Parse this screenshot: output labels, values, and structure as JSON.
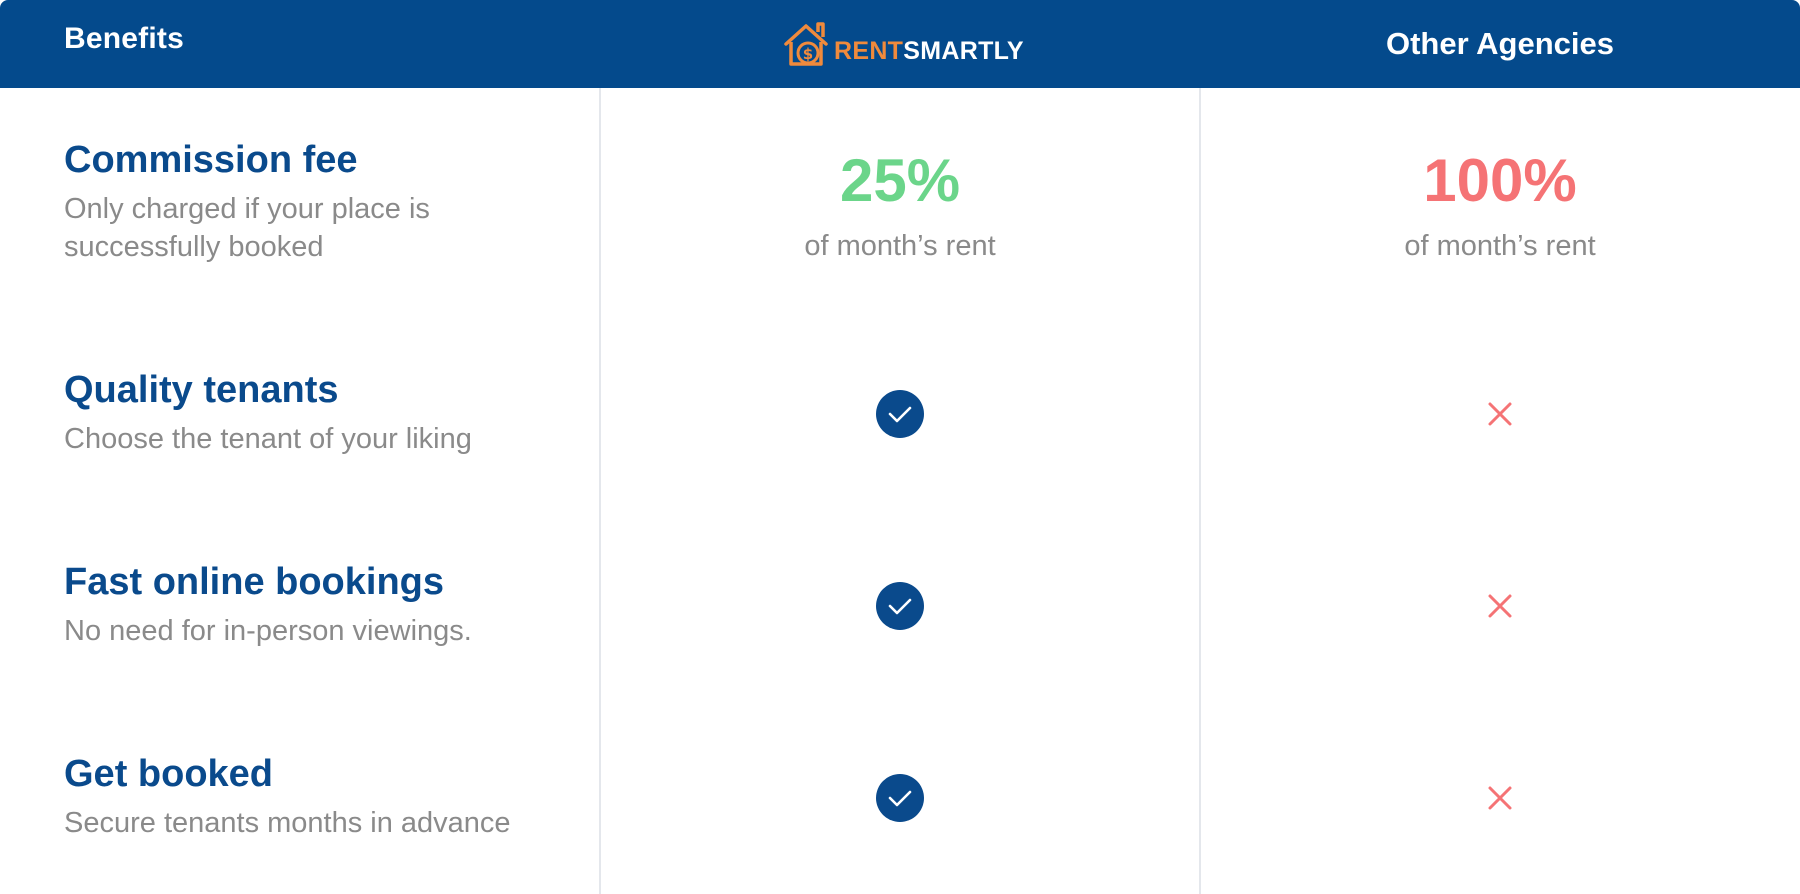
{
  "header": {
    "benefits_label": "Benefits",
    "logo": {
      "rent": "RENT",
      "smartly": "SMARTLY",
      "icon": "house-dollar-icon"
    },
    "other_label": "Other Agencies"
  },
  "colors": {
    "header_bg": "#044a8c",
    "accent_orange": "#f08a3c",
    "title_blue": "#0a4a8c",
    "good_green": "#6bd58a",
    "bad_red": "#f57375",
    "muted_text": "#8a8a8a"
  },
  "rows": [
    {
      "title": "Commission fee",
      "desc_line1": "Only charged if your place is",
      "desc_line2": "successfully booked",
      "rentsmartly": {
        "value": "25%",
        "sub": "of month’s rent"
      },
      "other": {
        "value": "100%",
        "sub": "of month’s rent"
      }
    },
    {
      "title": "Quality tenants",
      "desc": "Choose the tenant of your liking",
      "rentsmartly_icon": "check-circle-icon",
      "other_icon": "cross-icon"
    },
    {
      "title": "Fast online bookings",
      "desc": "No need for in-person viewings.",
      "rentsmartly_icon": "check-circle-icon",
      "other_icon": "cross-icon"
    },
    {
      "title": "Get booked",
      "desc": "Secure tenants months in advance",
      "rentsmartly_icon": "check-circle-icon",
      "other_icon": "cross-icon"
    }
  ]
}
